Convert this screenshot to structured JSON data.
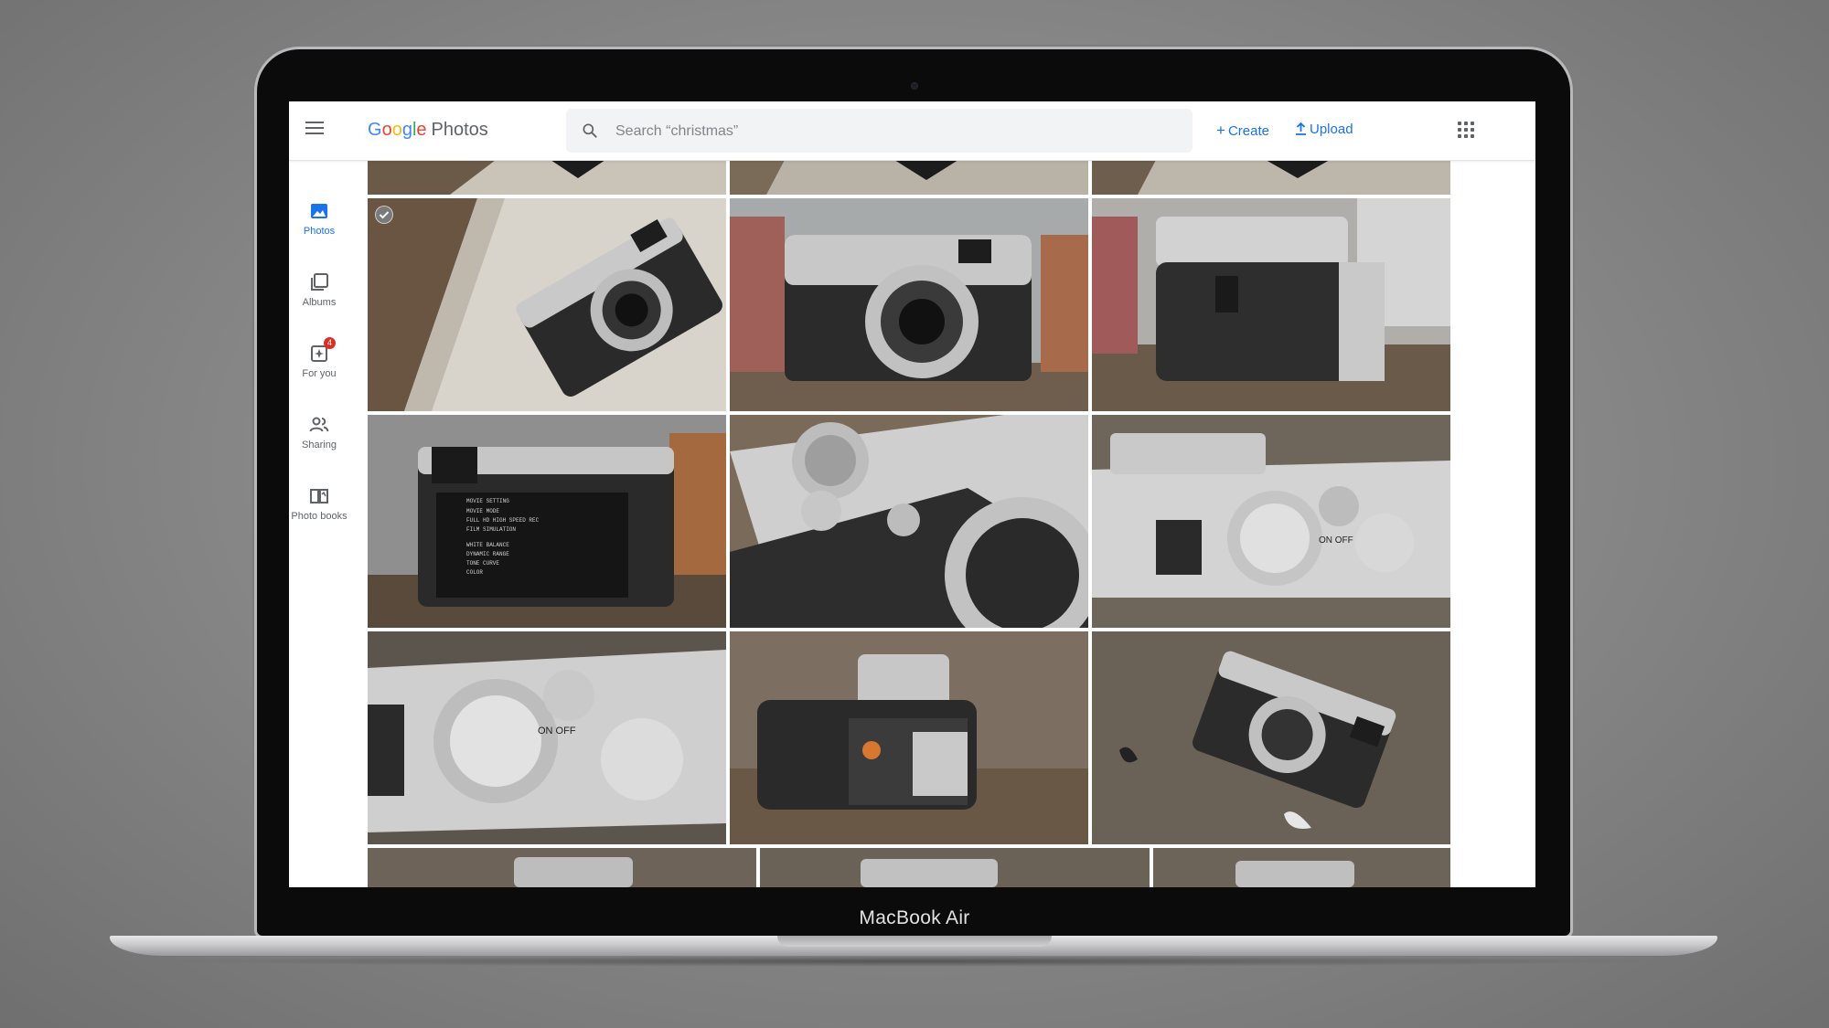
{
  "device": {
    "label": "MacBook Air"
  },
  "app": {
    "logo_google": [
      "G",
      "o",
      "o",
      "g",
      "l",
      "e"
    ],
    "logo_product": "Photos"
  },
  "search": {
    "placeholder": "Search “christmas”",
    "value": ""
  },
  "actions": {
    "create": "Create",
    "upload": "Upload"
  },
  "sidebar": {
    "items": [
      {
        "label": "Photos",
        "icon": "photo-icon",
        "active": true
      },
      {
        "label": "Albums",
        "icon": "albums-icon",
        "active": false
      },
      {
        "label": "For you",
        "icon": "for-you-icon",
        "active": false,
        "badge": "4"
      },
      {
        "label": "Sharing",
        "icon": "people-icon",
        "active": false
      },
      {
        "label": "Photo books",
        "icon": "book-icon",
        "active": false
      }
    ]
  },
  "grid": {
    "photos": [
      {
        "subject": "Camera partially visible, top crop",
        "selected": false
      },
      {
        "subject": "Camera partially visible, top crop",
        "selected": false
      },
      {
        "subject": "Camera partially visible, top crop",
        "selected": false
      },
      {
        "subject": "Silver rangefinder camera on white wood, angled",
        "selected": true
      },
      {
        "subject": "Silver compact camera front view",
        "selected": false
      },
      {
        "subject": "Camera side with grip and strap lug",
        "selected": false
      },
      {
        "subject": "Camera rear LCD with movie settings menu",
        "selected": false
      },
      {
        "subject": "Close-up of camera dials and lens",
        "selected": false
      },
      {
        "subject": "Camera top plate with shutter dial",
        "selected": false
      },
      {
        "subject": "Close-up of shutter speed dial",
        "selected": false
      },
      {
        "subject": "Camera battery compartment open",
        "selected": false
      },
      {
        "subject": "Camera on dark wood, top-down",
        "selected": false
      },
      {
        "subject": "Camera partially visible, bottom crop",
        "selected": false
      },
      {
        "subject": "Camera partially visible, bottom crop",
        "selected": false
      },
      {
        "subject": "Camera partially visible, bottom crop",
        "selected": false
      }
    ]
  },
  "lcd_menu": {
    "title": "MOVIE SETTING",
    "rows": [
      "MOVIE MODE",
      "FULL HD HIGH SPEED REC",
      "FILM SIMULATION",
      "WHITE BALANCE",
      "DYNAMIC RANGE",
      "TONE CURVE",
      "COLOR"
    ]
  },
  "dial_text": {
    "on_off": "ON OFF"
  },
  "colors": {
    "accent": "#1a73e8",
    "badge": "#d93025",
    "icon_gray": "#5f6368"
  }
}
